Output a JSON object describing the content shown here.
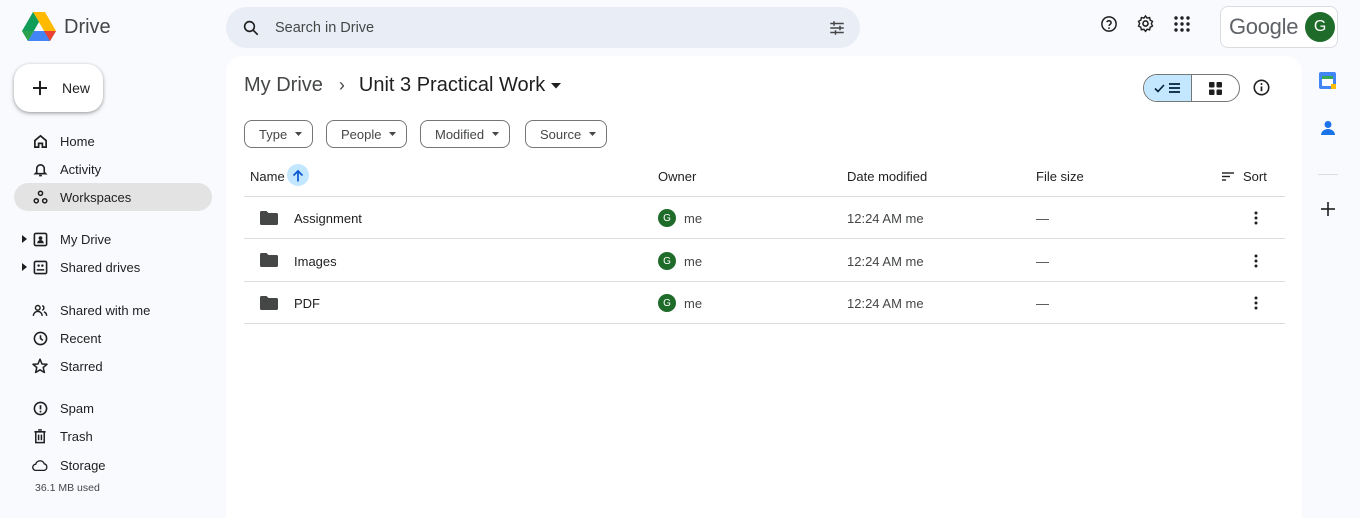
{
  "app": {
    "name": "Drive",
    "brand": "Google",
    "account_initial": "G"
  },
  "search": {
    "placeholder": "Search in Drive"
  },
  "sidebar": {
    "new_label": "New",
    "items": [
      {
        "label": "Home",
        "icon": "home-icon"
      },
      {
        "label": "Activity",
        "icon": "bell-icon"
      },
      {
        "label": "Workspaces",
        "icon": "workspaces-icon",
        "active": true
      },
      {
        "label": "My Drive",
        "icon": "my-drive-icon"
      },
      {
        "label": "Shared drives",
        "icon": "shared-drives-icon"
      },
      {
        "label": "Shared with me",
        "icon": "people-icon"
      },
      {
        "label": "Recent",
        "icon": "clock-icon"
      },
      {
        "label": "Starred",
        "icon": "star-icon"
      },
      {
        "label": "Spam",
        "icon": "spam-icon"
      },
      {
        "label": "Trash",
        "icon": "trash-icon"
      },
      {
        "label": "Storage",
        "icon": "cloud-icon"
      }
    ],
    "storage_used": "36.1 MB used"
  },
  "breadcrumb": {
    "root": "My Drive",
    "separator": "›",
    "current": "Unit 3 Practical Work"
  },
  "filters": [
    "Type",
    "People",
    "Modified",
    "Source"
  ],
  "table": {
    "columns": {
      "name": "Name",
      "owner": "Owner",
      "date": "Date modified",
      "size": "File size",
      "sort": "Sort"
    },
    "rows": [
      {
        "name": "Assignment",
        "owner_initial": "G",
        "owner": "me",
        "date": "12:24 AM me",
        "size": "—"
      },
      {
        "name": "Images",
        "owner_initial": "G",
        "owner": "me",
        "date": "12:24 AM me",
        "size": "—"
      },
      {
        "name": "PDF",
        "owner_initial": "G",
        "owner": "me",
        "date": "12:24 AM me",
        "size": "—"
      }
    ]
  },
  "colors": {
    "accent": "#0b57d0",
    "selected": "#c2e7ff",
    "avatar": "#1e6b2a",
    "surface": "#f8fafd"
  }
}
